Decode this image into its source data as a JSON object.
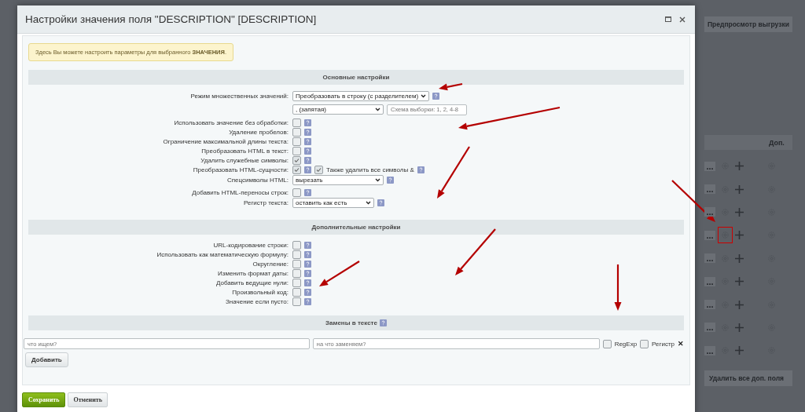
{
  "background": {
    "preview_button": "Предпросмотр выгрузки",
    "column_header": "Доп.",
    "rows": [
      {
        "menu": "...",
        "highlighted": false
      },
      {
        "menu": "...",
        "highlighted": false
      },
      {
        "menu": "...",
        "highlighted": false
      },
      {
        "menu": "...",
        "highlighted": true
      },
      {
        "menu": "...",
        "highlighted": false
      },
      {
        "menu": "...",
        "highlighted": false
      },
      {
        "menu": "...",
        "highlighted": false
      },
      {
        "menu": "...",
        "highlighted": false
      },
      {
        "menu": "...",
        "highlighted": false
      }
    ],
    "delete_button": "Удалить все доп. поля"
  },
  "dialog": {
    "title": "Настройки значения поля \"DESCRIPTION\" [DESCRIPTION]"
  },
  "info_note": "Здесь Вы можете настроить параметры для выбранного **ЗНАЧЕНИЯ**.",
  "sections": [
    {
      "title": "Основные настройки",
      "help": false,
      "rows": [
        {
          "label": "Режим множественных значений:",
          "controls": [
            {
              "kind": "select",
              "value": "Преобразовать в строку (с разделителем)"
            },
            {
              "kind": "help"
            }
          ],
          "sub": [
            {
              "kind": "select",
              "value": ", (запятая)"
            },
            {
              "kind": "input",
              "placeholder": "Схема выборки: 1, 2, 4-8"
            }
          ]
        },
        {
          "label": "Использовать значение без обработки:",
          "controls": [
            {
              "kind": "checkbox",
              "checked": false
            },
            {
              "kind": "help"
            }
          ]
        },
        {
          "label": "Удаление пробелов:",
          "controls": [
            {
              "kind": "checkbox",
              "checked": false
            },
            {
              "kind": "help"
            }
          ]
        },
        {
          "label": "Ограничение максимальной длины текста:",
          "controls": [
            {
              "kind": "checkbox",
              "checked": false
            },
            {
              "kind": "help"
            }
          ]
        },
        {
          "label": "Преобразовать HTML в текст:",
          "controls": [
            {
              "kind": "checkbox",
              "checked": false
            },
            {
              "kind": "help"
            }
          ]
        },
        {
          "label": "Удалить служебные символы:",
          "controls": [
            {
              "kind": "checkbox",
              "checked": true
            },
            {
              "kind": "help"
            }
          ]
        },
        {
          "label": "Преобразовать HTML-сущности:",
          "controls": [
            {
              "kind": "checkbox",
              "checked": true
            },
            {
              "kind": "help"
            },
            {
              "kind": "checkbox",
              "checked": true
            },
            {
              "kind": "text",
              "text": "Также удалить все символы &"
            },
            {
              "kind": "help"
            }
          ]
        },
        {
          "label": "Спецсимволы HTML:",
          "controls": [
            {
              "kind": "select",
              "value": "вырезать"
            },
            {
              "kind": "help"
            }
          ]
        },
        {
          "label": "Добавить HTML-переносы строк:",
          "controls": [
            {
              "kind": "checkbox",
              "checked": false
            },
            {
              "kind": "help"
            }
          ]
        },
        {
          "label": "Регистр текста:",
          "controls": [
            {
              "kind": "select",
              "value": "оставить как есть"
            },
            {
              "kind": "help"
            }
          ]
        }
      ]
    },
    {
      "title": "Дополнительные настройки",
      "help": false,
      "rows": [
        {
          "label": "URL-кодирование строки:",
          "controls": [
            {
              "kind": "checkbox",
              "checked": false
            },
            {
              "kind": "help"
            }
          ]
        },
        {
          "label": "Использовать как математическую формулу:",
          "controls": [
            {
              "kind": "checkbox",
              "checked": false
            },
            {
              "kind": "help"
            }
          ]
        },
        {
          "label": "Округление:",
          "controls": [
            {
              "kind": "checkbox",
              "checked": false
            },
            {
              "kind": "help"
            }
          ]
        },
        {
          "label": "Изменить формат даты:",
          "controls": [
            {
              "kind": "checkbox",
              "checked": false
            },
            {
              "kind": "help"
            }
          ]
        },
        {
          "label": "Добавить ведущие нули:",
          "controls": [
            {
              "kind": "checkbox",
              "checked": false
            },
            {
              "kind": "help"
            }
          ]
        },
        {
          "label": "Произвольный код:",
          "controls": [
            {
              "kind": "checkbox",
              "checked": false
            },
            {
              "kind": "help"
            }
          ]
        },
        {
          "label": "Значение если пусто:",
          "controls": [
            {
              "kind": "checkbox",
              "checked": false
            },
            {
              "kind": "help"
            }
          ]
        }
      ]
    },
    {
      "title": "Замены в тексте",
      "help": true
    }
  ],
  "replacement": {
    "search_placeholder": "что ищем?",
    "replace_placeholder": "на что заменяем?",
    "options": [
      {
        "label": "RegExp",
        "checked": false
      },
      {
        "label": "Регистр",
        "checked": false
      }
    ],
    "remove": "✕",
    "add_button": "Добавить"
  },
  "footer": {
    "save_button": "Сохранить",
    "cancel_button": "Отменить"
  }
}
